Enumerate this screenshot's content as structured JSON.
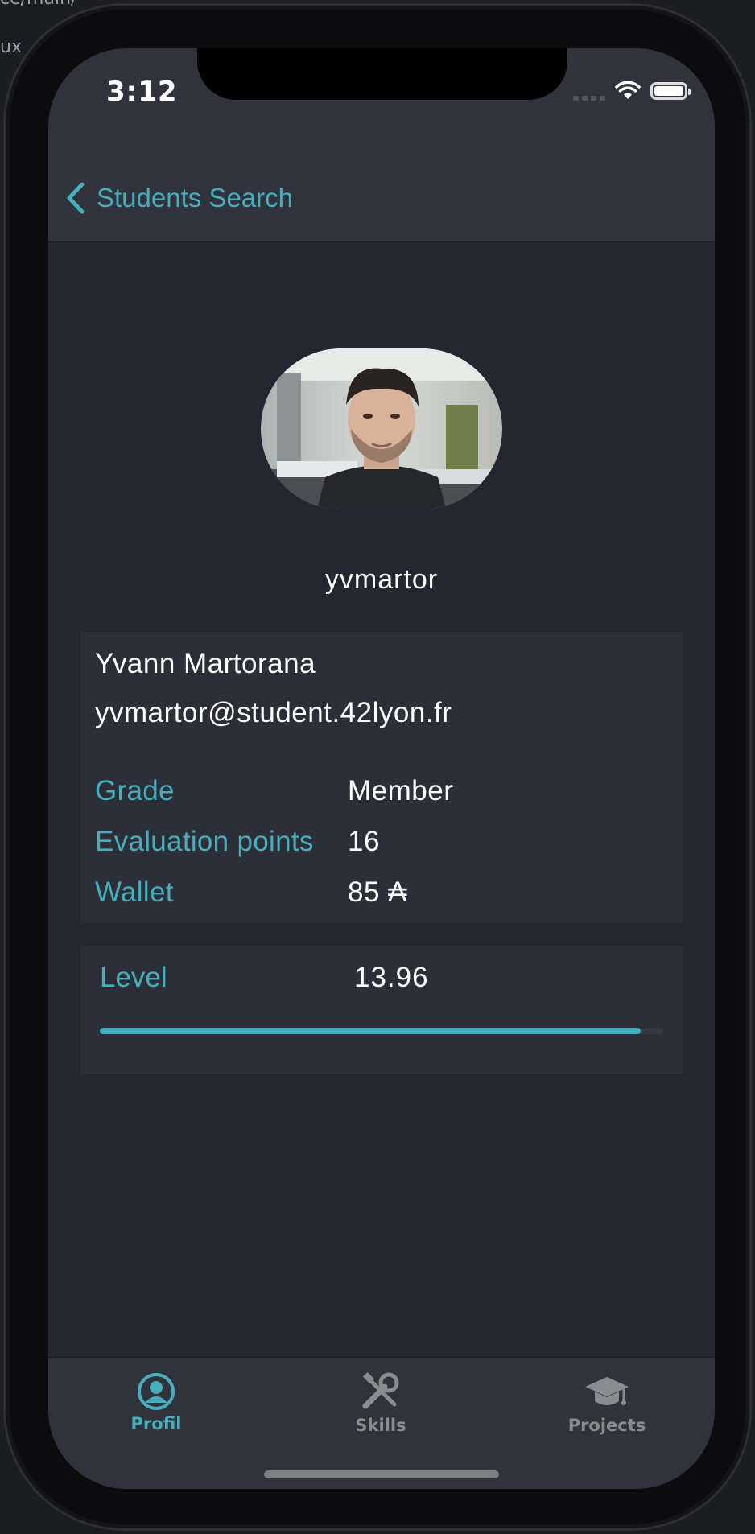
{
  "background_text": [
    "ce/main/",
    "ux"
  ],
  "status_bar": {
    "time": "3:12"
  },
  "nav": {
    "back_label": "Students Search"
  },
  "profile": {
    "login": "yvmartor",
    "full_name": "Yvann Martorana",
    "email": "yvmartor@student.42lyon.fr",
    "rows": [
      {
        "label": "Grade",
        "value": "Member"
      },
      {
        "label": "Evaluation points",
        "value": "16"
      },
      {
        "label": "Wallet",
        "value": "85 ₳"
      }
    ],
    "level": {
      "label": "Level",
      "value": "13.96",
      "progress": 0.96
    }
  },
  "tab_bar": {
    "items": [
      {
        "label": "Profil",
        "icon": "person-circle-icon",
        "active": true
      },
      {
        "label": "Skills",
        "icon": "tools-icon",
        "active": false
      },
      {
        "label": "Projects",
        "icon": "graduation-cap-icon",
        "active": false
      }
    ]
  },
  "colors": {
    "accent": "#46aebc",
    "background": "#242730",
    "card": "#2c2f37",
    "bar": "#30333b"
  }
}
